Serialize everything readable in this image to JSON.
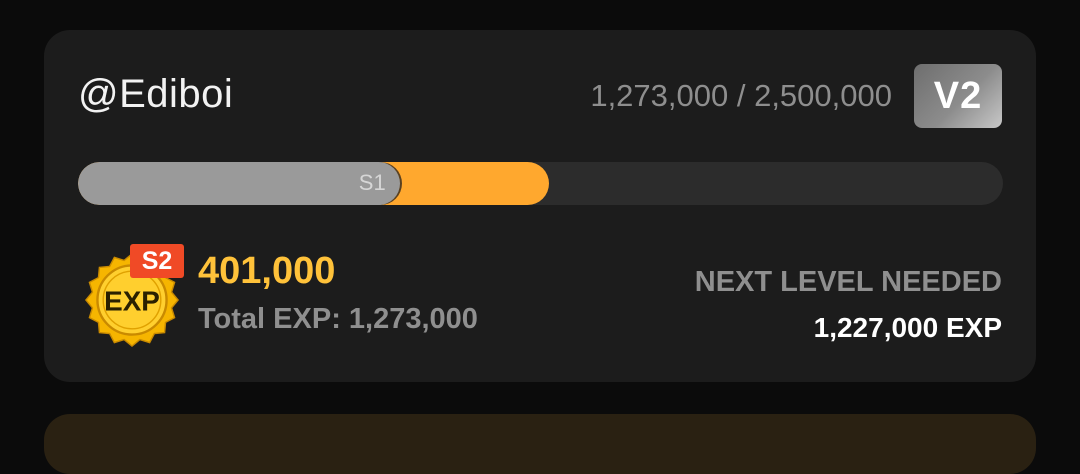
{
  "profile": {
    "username": "@Ediboi",
    "exp_progress_text": "1,273,000 / 2,500,000",
    "level_badge": "V2"
  },
  "progress": {
    "current_fraction": 0.509,
    "previous_fraction": 0.3478,
    "previous_season_label": "S1",
    "colors": {
      "current": "#ffa82e",
      "previous": "#9a9a9a",
      "track": "#2c2c2c"
    }
  },
  "exp": {
    "icon": "exp-coin-icon",
    "coin_text": "EXP",
    "season_tag": "S2",
    "season_value": "401,000",
    "total_text": "Total EXP: 1,273,000"
  },
  "next_level": {
    "title": "NEXT LEVEL NEEDED",
    "value": "1,227,000 EXP"
  },
  "colors": {
    "accent": "#ffc23a",
    "tag": "#f04a26"
  }
}
